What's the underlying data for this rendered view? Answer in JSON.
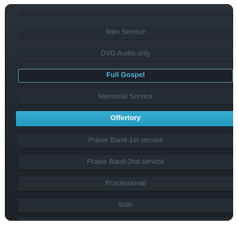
{
  "list": {
    "items": [
      {
        "label": "9am Service",
        "state": "normal"
      },
      {
        "label": "DVD Audio only",
        "state": "normal"
      },
      {
        "label": "Full Gospel",
        "state": "outlined"
      },
      {
        "label": "Memorial Service",
        "state": "normal"
      },
      {
        "label": "Offertory",
        "state": "selected"
      },
      {
        "label": "Praise Band-1st service",
        "state": "normal"
      },
      {
        "label": "Praise Band-2nd service",
        "state": "normal"
      },
      {
        "label": "Processional",
        "state": "normal"
      },
      {
        "label": "Solo",
        "state": "normal"
      }
    ]
  },
  "colors": {
    "panel_background": "#232a30",
    "row_background": "#252c32",
    "row_text": "#5d6a74",
    "outlined_text": "#4fb8dc",
    "outlined_border": "#5a8fa3",
    "selected_background": "#2a9fc2",
    "selected_text": "#ffffff"
  }
}
